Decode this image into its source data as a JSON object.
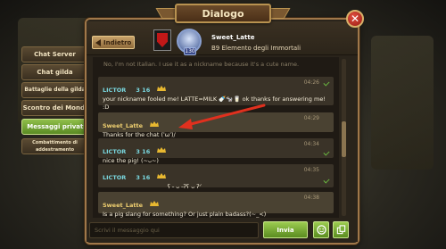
{
  "window": {
    "title": "Dialogo",
    "back_label": "Indietro"
  },
  "contact": {
    "name": "Sweet_Latte",
    "guild": "B9 Elemento degli Immortali",
    "level": "130"
  },
  "sidebar": {
    "items": [
      {
        "label": "Chat Server",
        "active": false
      },
      {
        "label": "Chat gilda",
        "active": false
      },
      {
        "label": "Battaglie della gilda",
        "active": false
      },
      {
        "label": "Scontro dei Mondi",
        "active": false
      },
      {
        "label": "Messaggi privati",
        "active": true
      },
      {
        "label": "Combattimento di addestramento",
        "active": false
      }
    ]
  },
  "chat": {
    "faded_line": "No, I'm not Italian. I use it as a nickname because it's a cute name.",
    "messages": [
      {
        "sender": "LICTOR",
        "level": "3 16",
        "time": "04:26",
        "text": "your nickname fooled me! LATTE=MILK 🍼🐄🥛 ok thanks for answering me! :D"
      },
      {
        "sender": "Sweet_Latte",
        "level": "",
        "time": "04:29",
        "text": "Thanks for the chat (ˈωˈ)/"
      },
      {
        "sender": "LICTOR",
        "level": "3 16",
        "time": "04:34",
        "text": "nice the pig! (~ᴗ~)"
      },
      {
        "sender": "LICTOR",
        "level": "3 16",
        "time": "04:35",
        "text": "ʕ⁠ ⁠˶⁠ ⁠ᴗ⁠ ⁠˶⁠ʔ⁠ʕ⁠ ⁠ᴗ⁠ ⁠ʔ⁠ᐟ"
      },
      {
        "sender": "Sweet_Latte",
        "level": "",
        "time": "04:38",
        "text": "Is a pig slang for something? Or just plain badass?(~_<)"
      }
    ]
  },
  "input": {
    "placeholder": "Scrivi il messaggio qui",
    "send_label": "Invia"
  },
  "colors": {
    "accent_green": "#5b8c24",
    "gold_border": "#a0784a",
    "annotation_red": "#e0301e"
  }
}
